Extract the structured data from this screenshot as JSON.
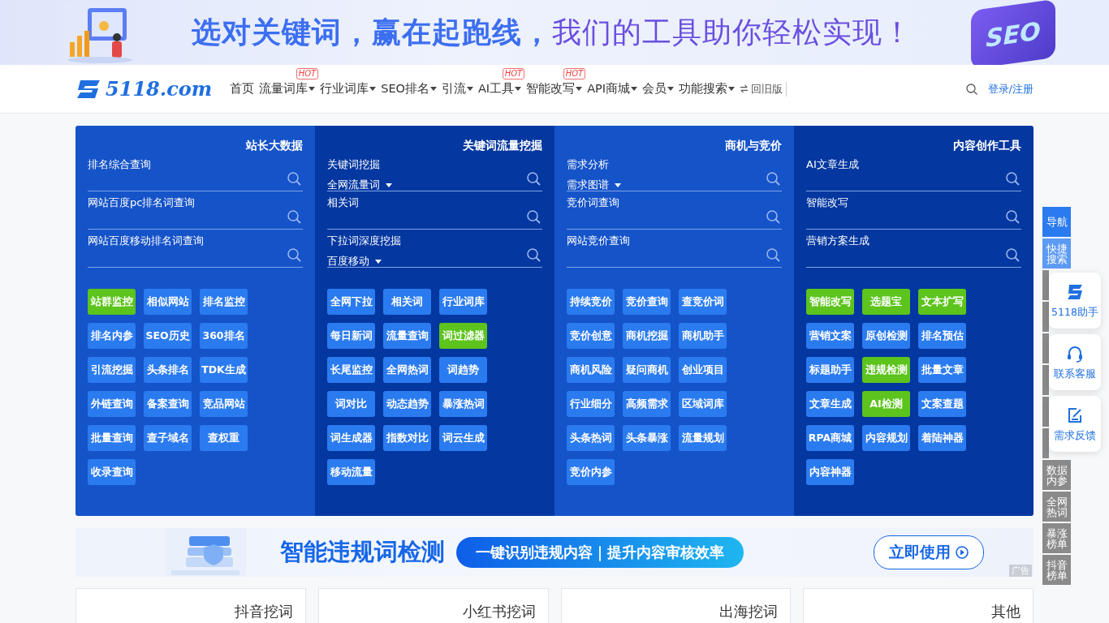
{
  "top_banner": {
    "headline_part_1": "选对关键词，赢在起跑线，",
    "headline_part_2": "我们的工具助你轻松实现！",
    "badge": "SEO"
  },
  "header": {
    "logo": "5118.com",
    "menu": [
      {
        "label": "首页",
        "dropdown": false
      },
      {
        "label": "流量词库",
        "dropdown": true,
        "badge": "HOT"
      },
      {
        "label": "行业词库",
        "dropdown": true
      },
      {
        "label": "SEO排名",
        "dropdown": true
      },
      {
        "label": "引流",
        "dropdown": true
      },
      {
        "label": "AI工具",
        "dropdown": true,
        "badge": "HOT"
      },
      {
        "label": "智能改写",
        "dropdown": true,
        "badge": "HOT"
      },
      {
        "label": "API商城",
        "dropdown": true
      },
      {
        "label": "会员",
        "dropdown": true
      },
      {
        "label": "功能搜索",
        "dropdown": true
      }
    ],
    "old_version": "回旧版",
    "login": "登录/注册"
  },
  "panels": [
    {
      "title": "站长大数据",
      "fields": [
        {
          "label": "排名综合查询"
        },
        {
          "label": "网站百度pc排名词查询"
        },
        {
          "label": "网站百度移动排名词查询"
        }
      ],
      "tools": [
        {
          "label": "站群监控",
          "color": "#5cc41c"
        },
        {
          "label": "相似网站",
          "color": "#2b7bf0"
        },
        {
          "label": "排名监控",
          "color": "#2b7bf0"
        },
        {
          "label": "排名内参",
          "color": "#2b7bf0"
        },
        {
          "label": "SEO历史",
          "color": "#2b7bf0"
        },
        {
          "label": "360排名",
          "color": "#2b7bf0"
        },
        {
          "label": "引流挖掘",
          "color": "#2b7bf0"
        },
        {
          "label": "头条排名",
          "color": "#2b7bf0"
        },
        {
          "label": "TDK生成",
          "color": "#2b7bf0"
        },
        {
          "label": "外链查询",
          "color": "#2b7bf0"
        },
        {
          "label": "备案查询",
          "color": "#2b7bf0"
        },
        {
          "label": "竞品网站",
          "color": "#2b7bf0"
        },
        {
          "label": "批量查询",
          "color": "#2b7bf0"
        },
        {
          "label": "查子域名",
          "color": "#2b7bf0"
        },
        {
          "label": "查权重",
          "color": "#2b7bf0"
        },
        {
          "label": "收录查询",
          "color": "#2b7bf0"
        }
      ]
    },
    {
      "title": "关键词流量挖掘",
      "fields": [
        {
          "label": "关键词挖掘",
          "select": "全网流量词"
        },
        {
          "label": "相关词"
        },
        {
          "label": "下拉词深度挖掘",
          "select": "百度移动"
        }
      ],
      "tools": [
        {
          "label": "全网下拉",
          "color": "#2b7bf0"
        },
        {
          "label": "相关词",
          "color": "#2b7bf0"
        },
        {
          "label": "行业词库",
          "color": "#2b7bf0"
        },
        {
          "label": "每日新词",
          "color": "#2b7bf0"
        },
        {
          "label": "流量查询",
          "color": "#2b7bf0"
        },
        {
          "label": "词过滤器",
          "color": "#5cc41c"
        },
        {
          "label": "长尾监控",
          "color": "#2b7bf0"
        },
        {
          "label": "全网热词",
          "color": "#2b7bf0"
        },
        {
          "label": "词趋势",
          "color": "#2b7bf0"
        },
        {
          "label": "词对比",
          "color": "#2b7bf0"
        },
        {
          "label": "动态趋势",
          "color": "#2b7bf0"
        },
        {
          "label": "暴涨热词",
          "color": "#2b7bf0"
        },
        {
          "label": "词生成器",
          "color": "#2b7bf0"
        },
        {
          "label": "指数对比",
          "color": "#2b7bf0"
        },
        {
          "label": "词云生成",
          "color": "#2b7bf0"
        },
        {
          "label": "移动流量",
          "color": "#2b7bf0"
        }
      ]
    },
    {
      "title": "商机与竞价",
      "fields": [
        {
          "label": "需求分析",
          "select": "需求图谱"
        },
        {
          "label": "竞价词查询"
        },
        {
          "label": "网站竞价查询"
        }
      ],
      "tools": [
        {
          "label": "持续竞价",
          "color": "#2b7bf0"
        },
        {
          "label": "竞价查询",
          "color": "#2b7bf0"
        },
        {
          "label": "查竞价词",
          "color": "#2b7bf0"
        },
        {
          "label": "竞价创意",
          "color": "#2b7bf0"
        },
        {
          "label": "商机挖掘",
          "color": "#2b7bf0"
        },
        {
          "label": "商机助手",
          "color": "#2b7bf0"
        },
        {
          "label": "商机风险",
          "color": "#2b7bf0"
        },
        {
          "label": "疑问商机",
          "color": "#2b7bf0"
        },
        {
          "label": "创业项目",
          "color": "#2b7bf0"
        },
        {
          "label": "行业细分",
          "color": "#2b7bf0"
        },
        {
          "label": "高频需求",
          "color": "#2b7bf0"
        },
        {
          "label": "区域词库",
          "color": "#2b7bf0"
        },
        {
          "label": "头条热词",
          "color": "#2b7bf0"
        },
        {
          "label": "头条暴涨",
          "color": "#2b7bf0"
        },
        {
          "label": "流量规划",
          "color": "#2b7bf0"
        },
        {
          "label": "竞价内参",
          "color": "#2b7bf0"
        }
      ]
    },
    {
      "title": "内容创作工具",
      "fields": [
        {
          "label": "AI文章生成"
        },
        {
          "label": "智能改写"
        },
        {
          "label": "营销方案生成"
        }
      ],
      "tools": [
        {
          "label": "智能改写",
          "color": "#5cc41c"
        },
        {
          "label": "选题宝",
          "color": "#5cc41c"
        },
        {
          "label": "文本扩写",
          "color": "#5cc41c"
        },
        {
          "label": "营销文案",
          "color": "#2b7bf0"
        },
        {
          "label": "原创检测",
          "color": "#2b7bf0"
        },
        {
          "label": "排名预估",
          "color": "#2b7bf0"
        },
        {
          "label": "标题助手",
          "color": "#2b7bf0"
        },
        {
          "label": "违规检测",
          "color": "#5cc41c"
        },
        {
          "label": "批量文章",
          "color": "#2b7bf0"
        },
        {
          "label": "文章生成",
          "color": "#2b7bf0"
        },
        {
          "label": "AI检测",
          "color": "#5cc41c"
        },
        {
          "label": "文案查题",
          "color": "#2b7bf0"
        },
        {
          "label": "RPA商城",
          "color": "#2b7bf0"
        },
        {
          "label": "内容规划",
          "color": "#2b7bf0"
        },
        {
          "label": "着陆神器",
          "color": "#2b7bf0"
        },
        {
          "label": "内容神器",
          "color": "#2b7bf0"
        }
      ]
    }
  ],
  "ad_banner": {
    "title": "智能违规词检测",
    "slogan": "一键识别违规内容｜提升内容审核效率",
    "button": "立即使用",
    "tag": "广告"
  },
  "category_cards": [
    {
      "title": "抖音挖词"
    },
    {
      "title": "小红书挖词"
    },
    {
      "title": "出海挖词"
    },
    {
      "title": "其他"
    }
  ],
  "side_nav": [
    {
      "label": "导航",
      "kind": "head"
    },
    {
      "label": "快捷搜索",
      "kind": "active"
    },
    {
      "kind": "hidden"
    },
    {
      "kind": "hidden"
    },
    {
      "kind": "hidden"
    },
    {
      "kind": "hidden"
    },
    {
      "kind": "hidden"
    },
    {
      "kind": "hidden"
    },
    {
      "label": "数据内参",
      "kind": "item"
    },
    {
      "label": "全网热词",
      "kind": "item"
    },
    {
      "label": "暴涨榜单",
      "kind": "item"
    },
    {
      "label": "抖音榜单",
      "kind": "item"
    }
  ],
  "float_buttons": [
    {
      "label": "5118助手",
      "kind": "logo"
    },
    {
      "label": "联系客服",
      "kind": "headset"
    },
    {
      "label": "需求反馈",
      "kind": "edit"
    }
  ]
}
